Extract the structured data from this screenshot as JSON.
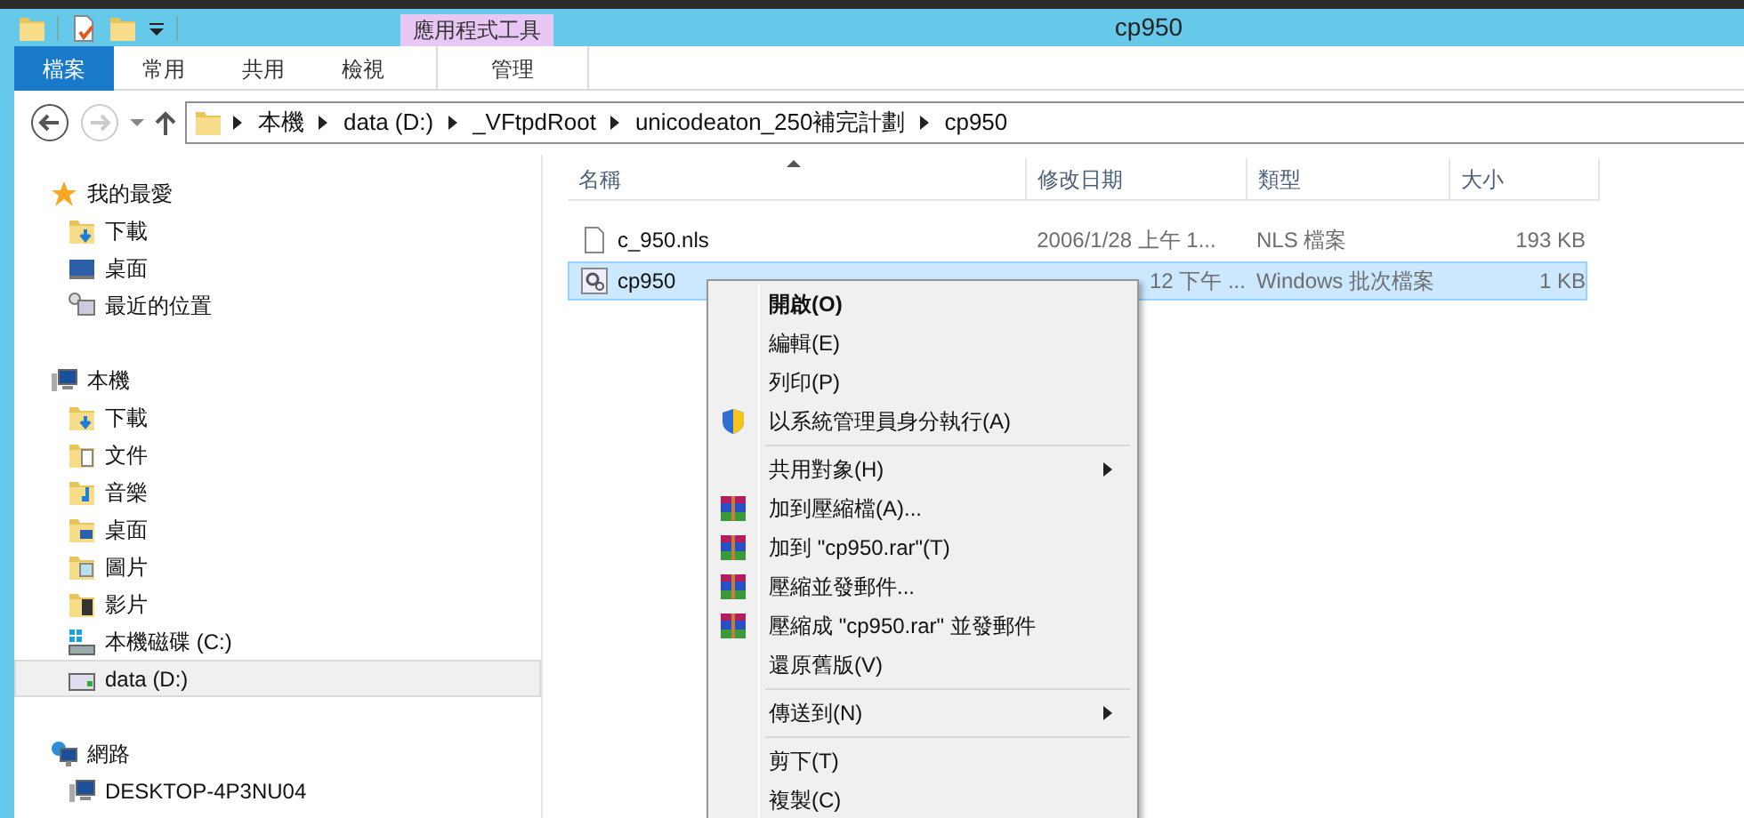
{
  "title_bar": {
    "title": "cp950",
    "contextual_group": "應用程式工具"
  },
  "ribbon_tabs": [
    {
      "label": "檔案",
      "kind": "file",
      "selected": false
    },
    {
      "label": "常用",
      "kind": "normal",
      "selected": false
    },
    {
      "label": "共用",
      "kind": "normal",
      "selected": false
    },
    {
      "label": "檢視",
      "kind": "normal",
      "selected": false
    },
    {
      "label": "管理",
      "kind": "contextual",
      "selected": false
    }
  ],
  "navigation": {
    "back_disabled": false,
    "forward_disabled": true
  },
  "breadcrumb": [
    "本機",
    "data (D:)",
    "_VFtpdRoot",
    "unicodeaton_250補完計劃",
    "cp950"
  ],
  "nav_pane": [
    {
      "label": "我的最愛",
      "kind": "favorites",
      "selected": false,
      "children": [
        {
          "label": "下載",
          "kind": "downloads",
          "selected": false
        },
        {
          "label": "桌面",
          "kind": "desktop",
          "selected": false
        },
        {
          "label": "最近的位置",
          "kind": "recent",
          "selected": false
        }
      ]
    },
    {
      "label": "本機",
      "kind": "computer",
      "selected": false,
      "children": [
        {
          "label": "下載",
          "kind": "downloads",
          "selected": false
        },
        {
          "label": "文件",
          "kind": "documents",
          "selected": false
        },
        {
          "label": "音樂",
          "kind": "music",
          "selected": false
        },
        {
          "label": "桌面",
          "kind": "desktop-folder",
          "selected": false
        },
        {
          "label": "圖片",
          "kind": "pictures",
          "selected": false
        },
        {
          "label": "影片",
          "kind": "videos",
          "selected": false
        },
        {
          "label": "本機磁碟 (C:)",
          "kind": "system-drive",
          "selected": false
        },
        {
          "label": "data (D:)",
          "kind": "drive",
          "selected": true
        }
      ]
    },
    {
      "label": "網路",
      "kind": "network",
      "selected": false,
      "children": [
        {
          "label": "DESKTOP-4P3NU04",
          "kind": "computer",
          "selected": false
        }
      ]
    }
  ],
  "file_list": {
    "columns": [
      {
        "label": "名稱",
        "sorted": true
      },
      {
        "label": "修改日期",
        "sorted": false
      },
      {
        "label": "類型",
        "sorted": false
      },
      {
        "label": "大小",
        "sorted": false
      }
    ],
    "rows": [
      {
        "name": "c_950.nls",
        "kind": "document",
        "date": "2006/1/28 上午 1...",
        "type": "NLS 檔案",
        "size": "193 KB",
        "selected": false
      },
      {
        "name": "cp950",
        "kind": "batch",
        "date": "12 下午 ...",
        "type": "Windows 批次檔案",
        "size": "1 KB",
        "selected": true
      }
    ]
  },
  "context_menu": [
    {
      "kind": "item",
      "label": "開啟(O)",
      "default": true,
      "submenu": false
    },
    {
      "kind": "item",
      "label": "編輯(E)",
      "default": false,
      "submenu": false
    },
    {
      "kind": "item",
      "label": "列印(P)",
      "default": false,
      "submenu": false
    },
    {
      "kind": "shield",
      "label": "以系統管理員身分執行(A)",
      "default": false,
      "submenu": false
    },
    {
      "kind": "separator"
    },
    {
      "kind": "item",
      "label": "共用對象(H)",
      "default": false,
      "submenu": true
    },
    {
      "kind": "archive",
      "label": "加到壓縮檔(A)...",
      "default": false,
      "submenu": false
    },
    {
      "kind": "archive",
      "label": "加到 \"cp950.rar\"(T)",
      "default": false,
      "submenu": false
    },
    {
      "kind": "archive",
      "label": "壓縮並發郵件...",
      "default": false,
      "submenu": false
    },
    {
      "kind": "archive",
      "label": "壓縮成 \"cp950.rar\" 並發郵件",
      "default": false,
      "submenu": false
    },
    {
      "kind": "item",
      "label": "還原舊版(V)",
      "default": false,
      "submenu": false
    },
    {
      "kind": "separator"
    },
    {
      "kind": "item",
      "label": "傳送到(N)",
      "default": false,
      "submenu": true
    },
    {
      "kind": "separator"
    },
    {
      "kind": "item",
      "label": "剪下(T)",
      "default": false,
      "submenu": false
    },
    {
      "kind": "item",
      "label": "複製(C)",
      "default": false,
      "submenu": false
    }
  ]
}
